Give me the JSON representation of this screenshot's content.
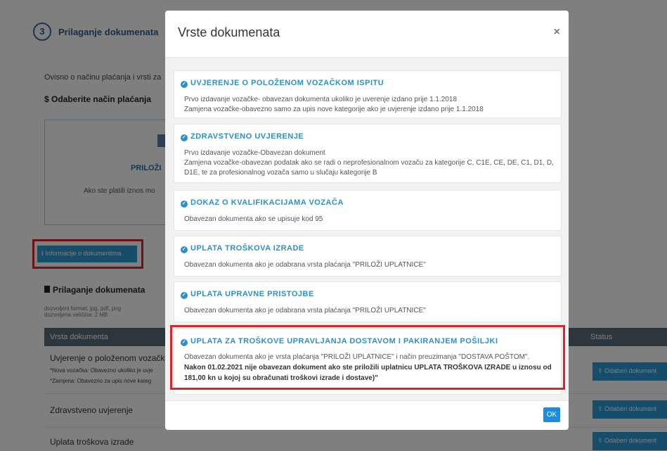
{
  "background": {
    "step_number": "3",
    "step_title": "Prilaganje dokumenata",
    "intro_text": "Ovisno o načinu plaćanja i vrsti za",
    "payment_heading": "$ Odaberite način plaćanja",
    "payment_option_label": "PRILOŽI",
    "payment_note": "Ako ste platili iznos mo",
    "info_button_label": "Informacije o dokumentima",
    "attach_heading": "Prilaganje dokumenata",
    "allowed_format": "dozvoljeni format: jpg, pdf, png",
    "allowed_size": "dozvoljena veličina: 2 MB",
    "table": {
      "col_document": "Vrsta dokumenta",
      "col_status": "Status",
      "rows": [
        {
          "title": "Uvjerenje o položenom vozačkom",
          "note1": "*Nova vozačka: Obavezno ukoliko je uvje",
          "note2": "*Zamjena: Obavezno za upis nove kateg",
          "button": "Odaberi dokument"
        },
        {
          "title": "Zdravstveno uvjerenje",
          "button": "Odaberi dokument"
        },
        {
          "title": "Uplata troškova izrade",
          "button": "Odaberi dokument"
        }
      ]
    }
  },
  "modal": {
    "title": "Vrste dokumenata",
    "close_label": "×",
    "ok_label": "OK",
    "cards": [
      {
        "title": "UVJERENJE O POLOŽENOM VOZAČKOM ISPITU",
        "lines": [
          "Prvo izdavanje vozačke- obavezan dokumenta ukoliko je uverenje izdano prije 1.1.2018",
          "Zamjena vozačke-obavezno samo za upis nove kategorije ako je uvjerenje izdano prije 1.1.2018"
        ]
      },
      {
        "title": "ZDRAVSTVENO UVJERENJE",
        "lines": [
          "Prvo izdavanje vozačke-Obavezan dokument",
          "Zamjena vozačke-obavezan podatak ako se radi o neprofesionalnom vozaču za kategorije C, C1E, CE, DE, C1, D1, D,",
          "D1E, te za profesionalnog vozača samo u slučaju kategorije B"
        ]
      },
      {
        "title": "DOKAZ O KVALIFIKACIJAMA VOZAČA",
        "lines": [
          "Obavezan dokumenta ako se upisuje kod 95"
        ]
      },
      {
        "title": "UPLATA TROŠKOVA IZRADE",
        "lines": [
          "Obavezan dokumenta ako je odabrana vrsta plaćanja \"PRILOŽI UPLATNICE\""
        ]
      },
      {
        "title": "UPLATA UPRAVNE PRISTOJBE",
        "lines": [
          "Obavezan dokumenta ako je odabrana vrsta plaćanja \"PRILOŽI UPLATNICE\""
        ]
      },
      {
        "title": "UPLATA ZA TROŠKOVE UPRAVLJANJA DOSTAVOM I PAKIRANJEM POŠILJKI",
        "lines": [
          "Obavezan dokumenta ako je vrsta plaćanja \"PRILOŽI UPLATNICE\" i način preuzimanja \"DOSTAVA POŠTOM\"."
        ],
        "bold_lines": [
          "Nakon 01.02.2021 nije obavezan dokument ako ste priložili uplatnicu UPLATA TROŠKOVA IZRADE u iznosu od",
          "181,00 kn u kojoj su obračunati troškovi izrade i dostave)\""
        ]
      }
    ]
  },
  "colors": {
    "accent": "#2c8fc9",
    "button": "#2b9ad6",
    "highlight": "#d9262c",
    "table_header": "#5a6a7b"
  }
}
